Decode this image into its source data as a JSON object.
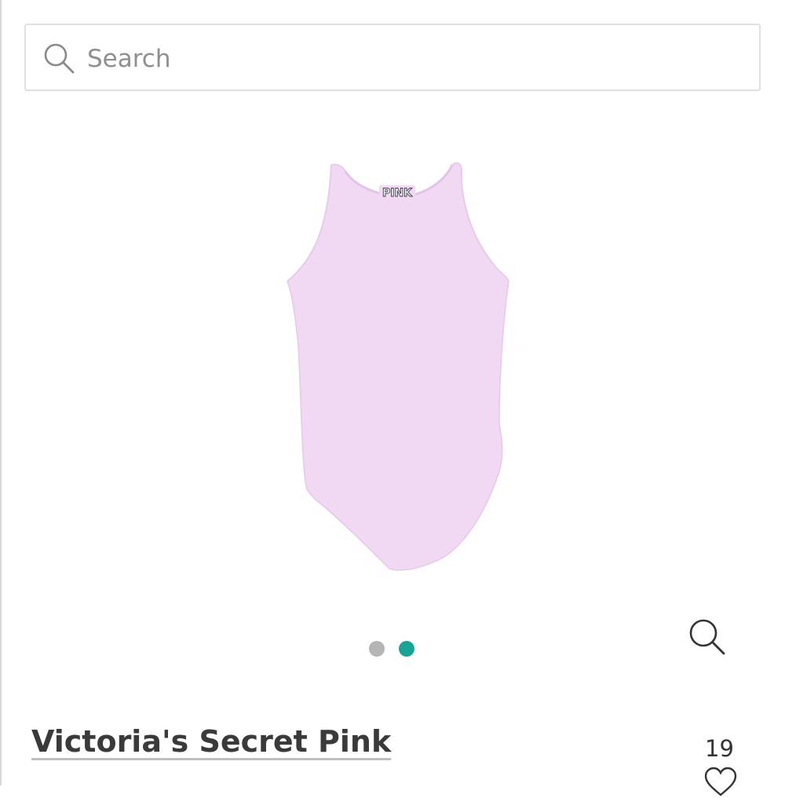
{
  "search": {
    "placeholder": "Search",
    "icon": "search-icon"
  },
  "product": {
    "image_logo_text": "PINK",
    "brand": "Victoria's Secret Pink",
    "like_count": "19"
  },
  "carousel": {
    "dots": [
      {
        "active": false,
        "color": "#b5b5b5"
      },
      {
        "active": true,
        "color": "#1aa394"
      }
    ]
  },
  "icons": {
    "zoom": "zoom-icon",
    "heart": "heart-icon"
  },
  "colors": {
    "garment": "#f1d8f3",
    "accent": "#1aa394"
  }
}
